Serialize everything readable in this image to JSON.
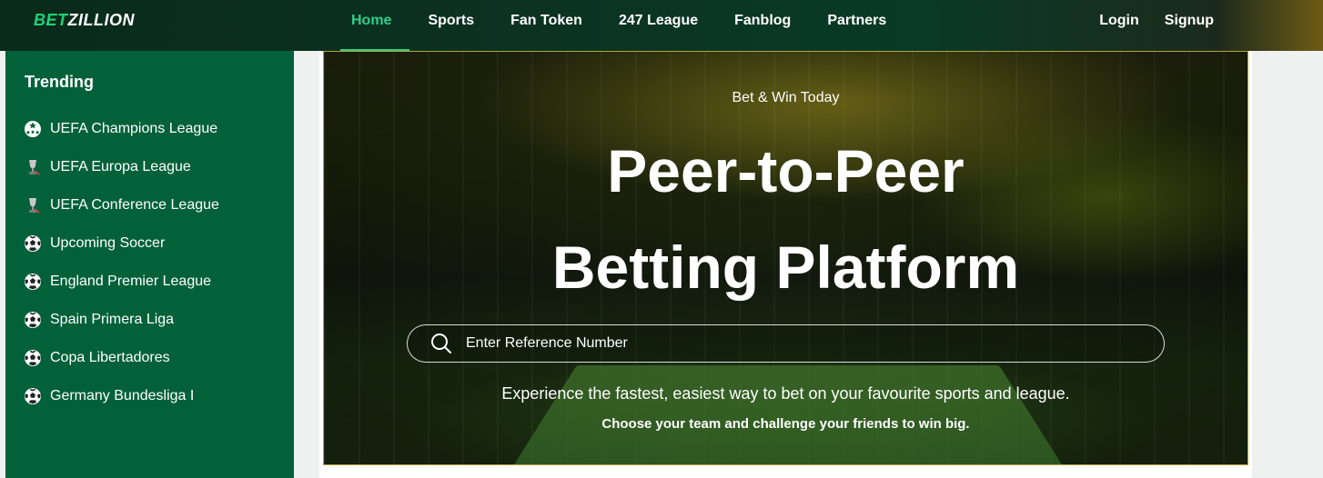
{
  "brand": {
    "logo_part1": "BET",
    "logo_part2": "ZILLION"
  },
  "nav": [
    {
      "label": "Home",
      "active": true
    },
    {
      "label": "Sports"
    },
    {
      "label": "Fan Token"
    },
    {
      "label": "247 League"
    },
    {
      "label": "Fanblog"
    },
    {
      "label": "Partners"
    }
  ],
  "auth": {
    "login": "Login",
    "signup": "Signup"
  },
  "sidebar": {
    "title": "Trending",
    "items": [
      {
        "label": "UEFA Champions League",
        "icon": "champions-league-icon"
      },
      {
        "label": "UEFA Europa League",
        "icon": "trophy-icon"
      },
      {
        "label": "UEFA Conference League",
        "icon": "trophy-icon"
      },
      {
        "label": "Upcoming Soccer",
        "icon": "soccer-ball-icon"
      },
      {
        "label": "England Premier League",
        "icon": "soccer-ball-icon"
      },
      {
        "label": "Spain Primera Liga",
        "icon": "soccer-ball-icon"
      },
      {
        "label": "Copa Libertadores",
        "icon": "soccer-ball-icon"
      },
      {
        "label": "Germany Bundesliga I",
        "icon": "soccer-ball-icon"
      }
    ]
  },
  "hero": {
    "subtitle": "Bet & Win Today",
    "title_line1": "Peer-to-Peer",
    "title_line2": "Betting Platform",
    "search_placeholder": "Enter Reference Number",
    "tagline": "Experience the fastest, easiest way to bet on your favourite sports and league.",
    "subtagline": "Choose your team and challenge your friends to win big."
  },
  "colors": {
    "accent": "#2fcf8a",
    "sidebar": "#03613a",
    "brand_green": "#1fd27a"
  }
}
